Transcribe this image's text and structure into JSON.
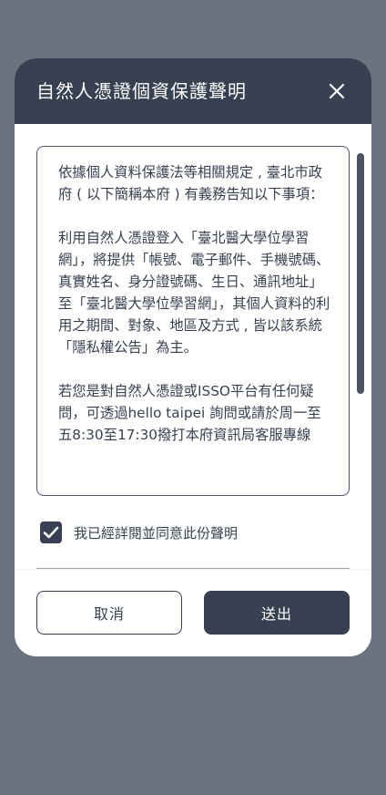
{
  "modal": {
    "title": "自然人憑證個資保護聲明",
    "close_icon": "close-icon"
  },
  "notice": {
    "paragraphs": [
      "依據個人資料保護法等相關規定 , 臺北市政府 ( 以下簡稱本府 ) 有義務告知以下事項：",
      "利用自然人憑證登入「臺北醫大學位學習網」，將提供「帳號、電子郵件、手機號碼、真實姓名、身分證號碼、生日、通訊地址」至「臺北醫大學位學習網」，其個人資料的利用之期間、對象、地區及方式 , 皆以該系統「隱私權公告」為主。",
      "若您是對自然人憑證或ISSO平台有任何疑問，可透過hello taipei 詢問或請於周一至五8:30至17:30撥打本府資訊局客服專線"
    ]
  },
  "agree": {
    "checked": true,
    "label": "我已經詳閱並同意此份聲明",
    "icon": "check-icon"
  },
  "actions": {
    "cancel_label": "取消",
    "submit_label": "送出"
  },
  "colors": {
    "backdrop": "#6b7280",
    "header": "#374151",
    "primary": "#374151",
    "surface": "#ffffff"
  }
}
